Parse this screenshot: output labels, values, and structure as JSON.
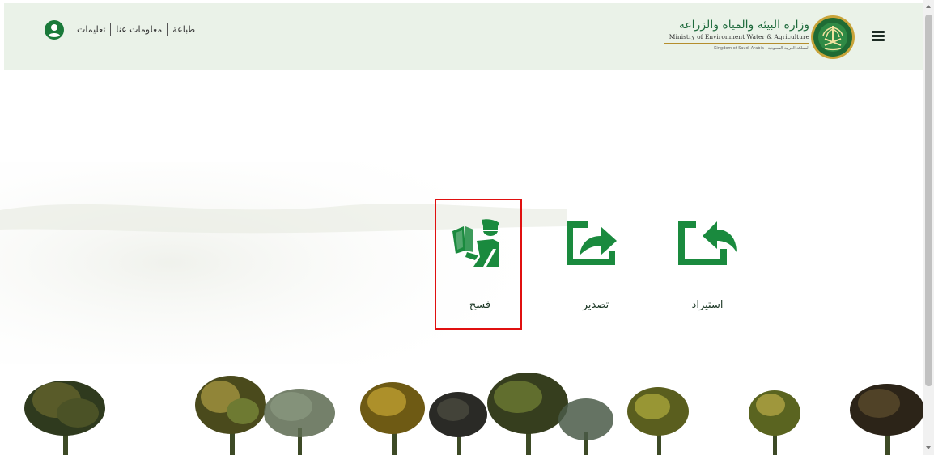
{
  "header": {
    "logo": {
      "title_ar": "وزارة البيئة والمياه والزراعة",
      "title_en": "Ministry of Environment Water & Agriculture",
      "subtitle": "Kingdom of Saudi Arabia · المملكة العربية السعودية"
    },
    "links": [
      "طباعة",
      "معلومات عنا",
      "تعليمات"
    ],
    "menu_icon": "hamburger-icon",
    "user_icon": "user-circle-icon"
  },
  "actions": [
    {
      "label": "استيراد",
      "icon": "import-icon"
    },
    {
      "label": "تصدير",
      "icon": "export-icon"
    },
    {
      "label": "فسح",
      "icon": "inspector-icon",
      "selected": true
    }
  ],
  "colors": {
    "header_bg": "#eaf2e8",
    "brand_green": "#1a8a3e",
    "selection": "#e01010"
  }
}
